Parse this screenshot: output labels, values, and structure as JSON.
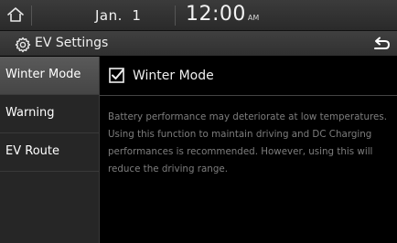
{
  "status_bar": {
    "date": "Jan.  1",
    "time": "12:00",
    "ampm": "AM"
  },
  "title_bar": {
    "title": "EV Settings"
  },
  "sidebar": {
    "items": [
      {
        "label": "Winter Mode",
        "active": true
      },
      {
        "label": "Warning",
        "active": false
      },
      {
        "label": "EV Route",
        "active": false
      }
    ]
  },
  "content": {
    "checkbox_label": "Winter Mode",
    "checkbox_checked": true,
    "description": "Battery performance may deteriorate at low temperatures. Using this function to maintain driving and DC Charging performances is recommended. However, using this will reduce the driving range."
  },
  "icons": {
    "home": "home-icon",
    "settings": "gear-icon",
    "back": "back-arrow-icon",
    "checkbox": "checkbox-checked-icon"
  }
}
